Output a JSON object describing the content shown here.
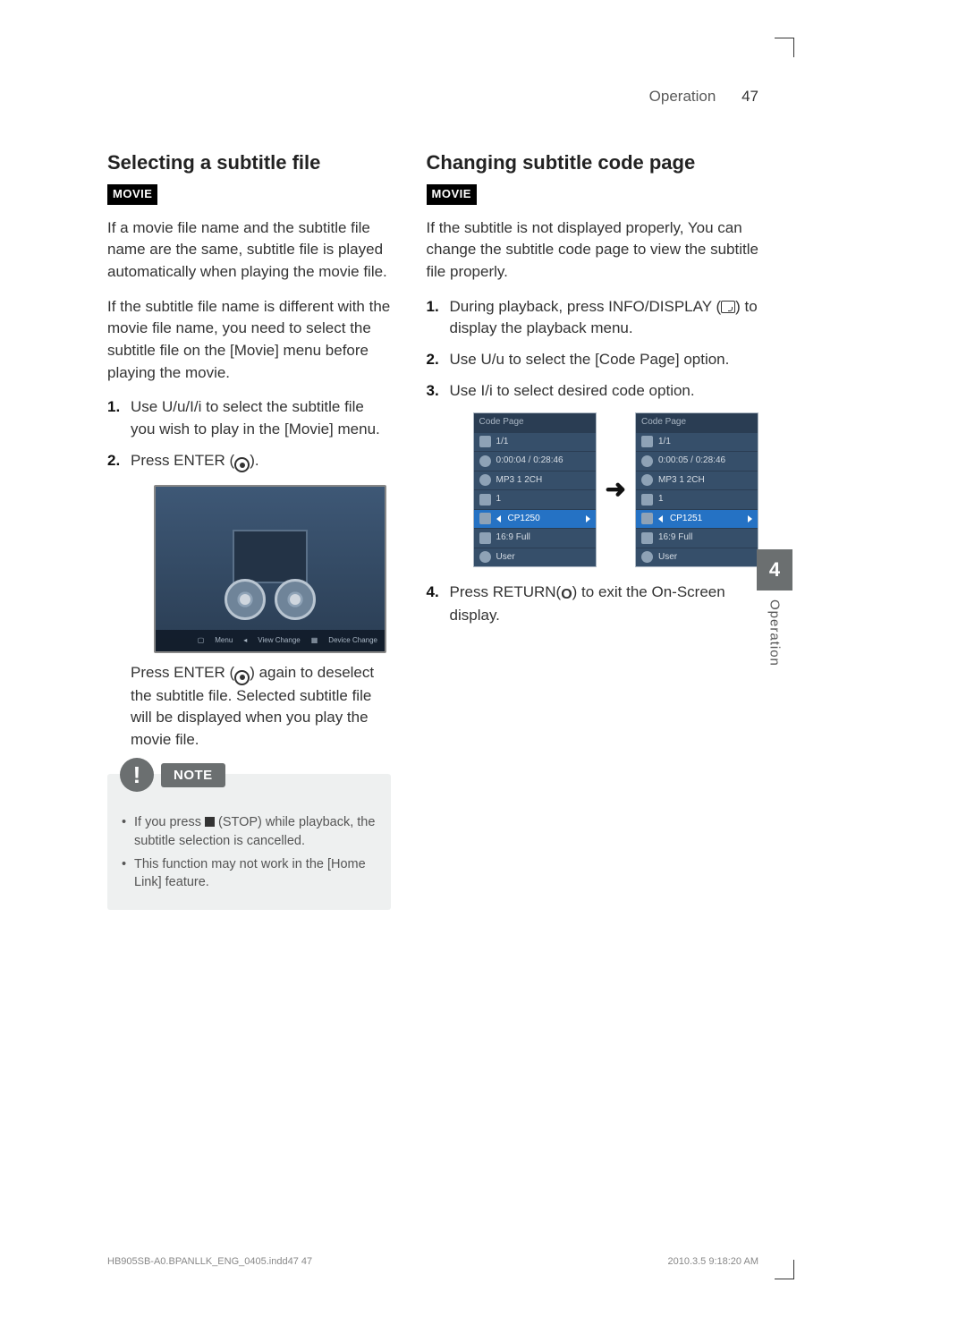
{
  "header": {
    "chapter": "Operation",
    "page": "47"
  },
  "left": {
    "h2": "Selecting a subtitle file",
    "tag": "MOVIE",
    "p1": "If a movie file name and the subtitle file name are the same, subtitle file is played automatically when playing the movie file.",
    "p2": "If the subtitle file name is different with the movie file name, you need to select the subtitle file on the [Movie] menu before playing the movie.",
    "step1a": "Use ",
    "step1b": " to select the subtitle file you wish to play in the [Movie] menu.",
    "step2a": "Press ENTER (",
    "step2b": ").",
    "shot_bar": {
      "menu": "Menu",
      "view": "View Change",
      "device": "Device Change"
    },
    "sub2a": "Press ENTER (",
    "sub2b": ") again to deselect the subtitle file. Selected subtitle file will be displayed when you play the movie file.",
    "note_label": "NOTE",
    "note1a": "If you press ",
    "note1b": " (STOP) while playback, the subtitle selection is cancelled.",
    "note2": "This function may not work in the [Home Link] feature."
  },
  "right": {
    "h2": "Changing subtitle code page",
    "tag": "MOVIE",
    "p1": "If the subtitle is not displayed properly, You can change the subtitle code page to view the subtitle file properly.",
    "step1a": "During playback, press INFO/DISPLAY (",
    "step1b": ") to display the playback menu.",
    "step2a": "Use ",
    "step2b": " to select the [Code Page] option.",
    "step3a": "Use ",
    "step3b": " to select desired code option.",
    "cp_title": "Code Page",
    "cp_rows": {
      "r1": "1/1",
      "r2a": "0:00:04 / 0:28:46",
      "r2b": "0:00:05 / 0:28:46",
      "r3": "MP3 1 2CH",
      "r4": "1",
      "r5a": "CP1250",
      "r5b": "CP1251",
      "r6": "16:9 Full",
      "r7": "User"
    },
    "step4a": "Press RETURN(",
    "step4b": ") to exit the On-Screen display."
  },
  "sidetab": {
    "num": "4",
    "label": "Operation"
  },
  "footer": {
    "left": "HB905SB-A0.BPANLLK_ENG_0405.indd47   47",
    "right": "2010.3.5   9:18:20 AM"
  },
  "glyphs": {
    "all4": "U/u/I/i",
    "ud": "U/u",
    "lr": "I/i",
    "return": "O",
    "arrow": "➜",
    "caret_l": "◂",
    "caret_r": "▸"
  }
}
